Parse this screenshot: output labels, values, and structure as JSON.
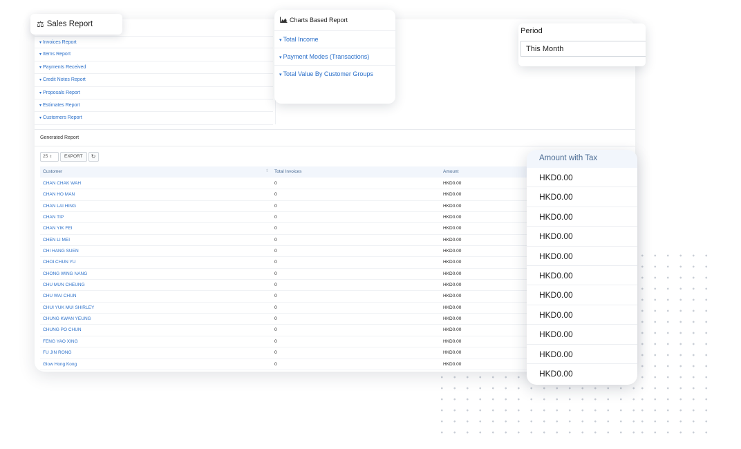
{
  "sales_card": {
    "title": "Sales Report",
    "icon": "scale-icon"
  },
  "report_links": [
    "Invoices Report",
    "Items Report",
    "Payments Received",
    "Credit Notes Report",
    "Proposals Report",
    "Estimates Report",
    "Customers Report"
  ],
  "charts_card": {
    "title": "Charts Based Report",
    "icon": "area-chart-icon",
    "links": [
      "Total Income",
      "Payment Modes (Transactions)",
      "Total Value By Customer Groups"
    ]
  },
  "period": {
    "label": "Period",
    "value": "This Month"
  },
  "generated_report": {
    "title": "Generated Report",
    "page_size": "25",
    "export_label": "EXPORT",
    "columns": {
      "customer": "Customer",
      "total_invoices": "Total Invoices",
      "amount": "Amount"
    },
    "rows": [
      {
        "customer": "CHAN CHAK WAH",
        "invoices": "0",
        "amount": "HKD0.00"
      },
      {
        "customer": "CHAN HO MAN",
        "invoices": "0",
        "amount": "HKD0.00"
      },
      {
        "customer": "CHAN LAI HING",
        "invoices": "0",
        "amount": "HKD0.00"
      },
      {
        "customer": "CHAN TIP",
        "invoices": "0",
        "amount": "HKD0.00"
      },
      {
        "customer": "CHAN YIK FEI",
        "invoices": "0",
        "amount": "HKD0.00"
      },
      {
        "customer": "CHEN LI MEI",
        "invoices": "0",
        "amount": "HKD0.00"
      },
      {
        "customer": "CHI HANG SUEN",
        "invoices": "0",
        "amount": "HKD0.00"
      },
      {
        "customer": "CHOI CHUN YU",
        "invoices": "0",
        "amount": "HKD0.00"
      },
      {
        "customer": "CHONG WING NANG",
        "invoices": "0",
        "amount": "HKD0.00"
      },
      {
        "customer": "CHU MUN CHEUNG",
        "invoices": "0",
        "amount": "HKD0.00"
      },
      {
        "customer": "CHU WAI CHUN",
        "invoices": "0",
        "amount": "HKD0.00"
      },
      {
        "customer": "CHUI YUK MUI SHIRLEY",
        "invoices": "0",
        "amount": "HKD0.00"
      },
      {
        "customer": "CHUNG KWAN YEUNG",
        "invoices": "0",
        "amount": "HKD0.00"
      },
      {
        "customer": "CHUNG PO CHUN",
        "invoices": "0",
        "amount": "HKD0.00"
      },
      {
        "customer": "FENG YAO XING",
        "invoices": "0",
        "amount": "HKD0.00"
      },
      {
        "customer": "FU JIN RONG",
        "invoices": "0",
        "amount": "HKD0.00"
      },
      {
        "customer": "Glow Hong Kong",
        "invoices": "0",
        "amount": "HKD0.00"
      }
    ]
  },
  "amount_with_tax": {
    "header": "Amount with Tax",
    "values": [
      "HKD0.00",
      "HKD0.00",
      "HKD0.00",
      "HKD0.00",
      "HKD0.00",
      "HKD0.00",
      "HKD0.00",
      "HKD0.00",
      "HKD0.00",
      "HKD0.00",
      "HKD0.00"
    ]
  }
}
